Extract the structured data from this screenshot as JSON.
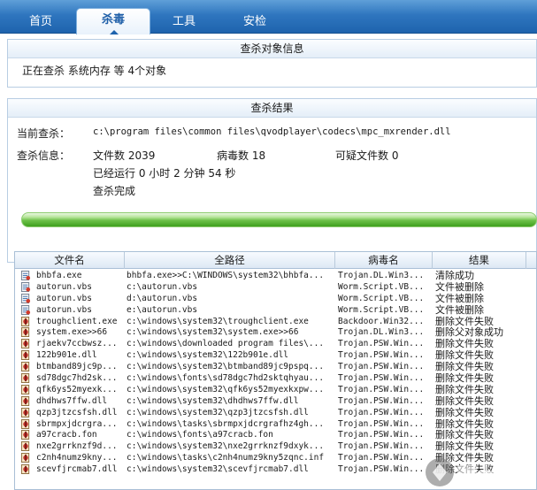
{
  "tabs": [
    {
      "label": "首页"
    },
    {
      "label": "杀毒"
    },
    {
      "label": "工具"
    },
    {
      "label": "安检"
    }
  ],
  "scan_target": {
    "title": "查杀对象信息",
    "status_text": "正在查杀  系统内存  等 4个对象"
  },
  "scan_result": {
    "title": "查杀结果",
    "current_label": "当前查杀：",
    "current_path": "c:\\program files\\common files\\qvodplayer\\codecs\\mpc_mxrender.dll",
    "info_label": "查杀信息：",
    "file_count": "文件数 2039",
    "virus_count": "病毒数 18",
    "suspicious_count": "可疑文件数 0",
    "elapsed": "已经运行 0 小时 2 分钟 54  秒",
    "done": "查杀完成",
    "progress": 1.0
  },
  "table": {
    "columns": [
      "文件名",
      "全路径",
      "病毒名",
      "结果"
    ],
    "rows": [
      {
        "icon": "script-file-icon",
        "name": "bhbfa.exe",
        "path": "bhbfa.exe>>C:\\WINDOWS\\system32\\bhbfa...",
        "virus": "Trojan.DL.Win3...",
        "result": "清除成功"
      },
      {
        "icon": "script-file-icon",
        "name": "autorun.vbs",
        "path": "c:\\autorun.vbs",
        "virus": "Worm.Script.VB...",
        "result": "文件被删除"
      },
      {
        "icon": "script-file-icon",
        "name": "autorun.vbs",
        "path": "d:\\autorun.vbs",
        "virus": "Worm.Script.VB...",
        "result": "文件被删除"
      },
      {
        "icon": "script-file-icon",
        "name": "autorun.vbs",
        "path": "e:\\autorun.vbs",
        "virus": "Worm.Script.VB...",
        "result": "文件被删除"
      },
      {
        "icon": "virus-file-icon",
        "name": "troughclient.exe",
        "path": "c:\\windows\\system32\\troughclient.exe",
        "virus": "Backdoor.Win32...",
        "result": "删除文件失败"
      },
      {
        "icon": "virus-file-icon",
        "name": "system.exe>>66",
        "path": "c:\\windows\\system32\\system.exe>>66",
        "virus": "Trojan.DL.Win3...",
        "result": "删除父对象成功"
      },
      {
        "icon": "virus-file-icon",
        "name": "rjaekv7ccbwsz...",
        "path": "c:\\windows\\downloaded program files\\...",
        "virus": "Trojan.PSW.Win...",
        "result": "删除文件失败"
      },
      {
        "icon": "virus-file-icon",
        "name": "122b901e.dll",
        "path": "c:\\windows\\system32\\122b901e.dll",
        "virus": "Trojan.PSW.Win...",
        "result": "删除文件失败"
      },
      {
        "icon": "virus-file-icon",
        "name": "btmband89jc9p...",
        "path": "c:\\windows\\system32\\btmband89jc9pspq...",
        "virus": "Trojan.PSW.Win...",
        "result": "删除文件失败"
      },
      {
        "icon": "virus-file-icon",
        "name": "sd78dgc7hd2sk...",
        "path": "c:\\windows\\fonts\\sd78dgc7hd2sktqhyau...",
        "virus": "Trojan.PSW.Win...",
        "result": "删除文件失败"
      },
      {
        "icon": "virus-file-icon",
        "name": "qfk6ys52myexk...",
        "path": "c:\\windows\\system32\\qfk6ys52myexkxpw...",
        "virus": "Trojan.PSW.Win...",
        "result": "删除文件失败"
      },
      {
        "icon": "virus-file-icon",
        "name": "dhdhws7ffw.dll",
        "path": "c:\\windows\\system32\\dhdhws7ffw.dll",
        "virus": "Trojan.PSW.Win...",
        "result": "删除文件失败"
      },
      {
        "icon": "virus-file-icon",
        "name": "qzp3jtzcsfsh.dll",
        "path": "c:\\windows\\system32\\qzp3jtzcsfsh.dll",
        "virus": "Trojan.PSW.Win...",
        "result": "删除文件失败"
      },
      {
        "icon": "virus-file-icon",
        "name": "sbrmpxjdcrgra...",
        "path": "c:\\windows\\tasks\\sbrmpxjdcrgrafhz4gh...",
        "virus": "Trojan.PSW.Win...",
        "result": "删除文件失败"
      },
      {
        "icon": "virus-file-icon",
        "name": "a97cracb.fon",
        "path": "c:\\windows\\fonts\\a97cracb.fon",
        "virus": "Trojan.PSW.Win...",
        "result": "删除文件失败"
      },
      {
        "icon": "virus-file-icon",
        "name": "nxe2grrknzf9d...",
        "path": "c:\\windows\\system32\\nxe2grrknzf9dxyk...",
        "virus": "Trojan.PSW.Win...",
        "result": "删除文件失败"
      },
      {
        "icon": "virus-file-icon",
        "name": "c2nh4numz9kny...",
        "path": "c:\\windows\\tasks\\c2nh4numz9kny5zqnc.inf",
        "virus": "Trojan.PSW.Win...",
        "result": "删除文件失败"
      },
      {
        "icon": "virus-file-icon",
        "name": "scevfjrcmab7.dll",
        "path": "c:\\windows\\system32\\scevfjrcmab7.dll",
        "virus": "Trojan.PSW.Win...",
        "result": "删除文件失败"
      }
    ]
  },
  "colors": {
    "tab_bar": "#2f76bf",
    "active_tab_text": "#1f5fa8",
    "progress_fill": "#3ea01d",
    "panel_border": "#b8cde3"
  }
}
